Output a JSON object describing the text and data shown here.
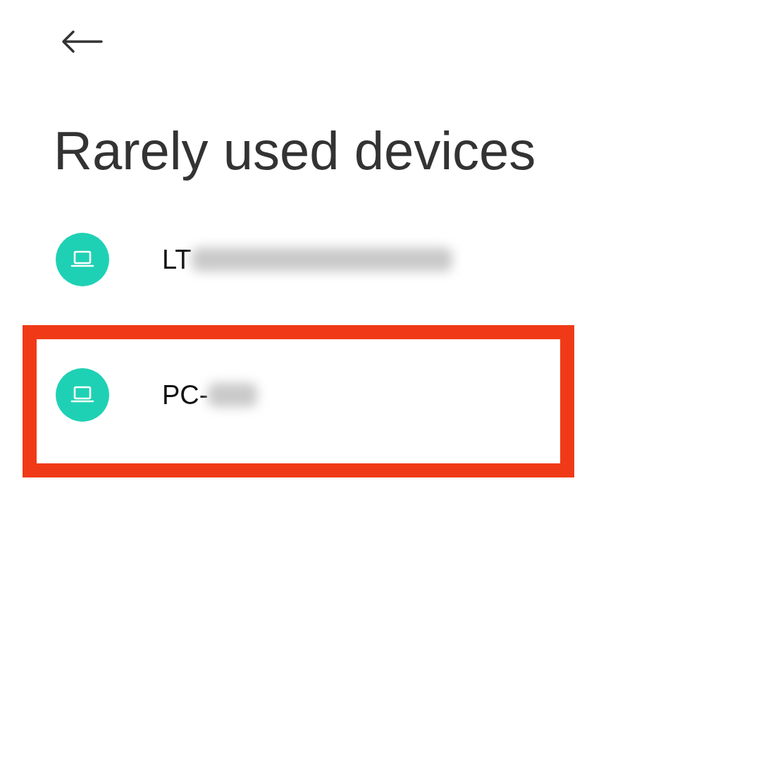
{
  "title": "Rarely used devices",
  "devices": [
    {
      "name": "LT",
      "redacted": true,
      "highlighted": false
    },
    {
      "name": "PC-",
      "redacted": true,
      "highlighted": true
    }
  ]
}
